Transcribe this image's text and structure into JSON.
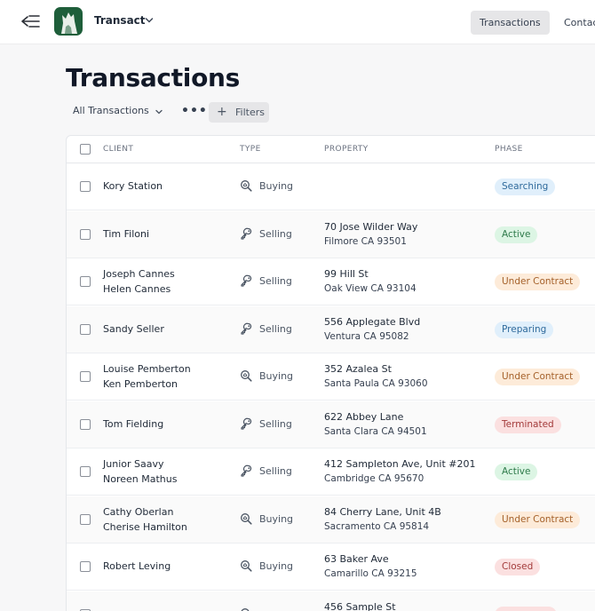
{
  "header": {
    "app_name": "Transact",
    "tabs": [
      {
        "label": "Transactions",
        "active": true
      },
      {
        "label": "Contacts",
        "active": false
      }
    ]
  },
  "page": {
    "title": "Transactions",
    "view_select": "All Transactions",
    "filters_label": "Filters"
  },
  "table": {
    "columns": [
      "CLIENT",
      "TYPE",
      "PROPERTY",
      "PHASE"
    ],
    "rows": [
      {
        "clients": [
          "Kory Station"
        ],
        "type": "Buying",
        "type_icon": "search-home-icon",
        "address": "",
        "city": "",
        "phase": "Searching",
        "phase_color": "blue"
      },
      {
        "clients": [
          "Tim Filoni"
        ],
        "type": "Selling",
        "type_icon": "key-icon",
        "address": "70 Jose Wilder Way",
        "city": "Filmore CA 93501",
        "phase": "Active",
        "phase_color": "green"
      },
      {
        "clients": [
          "Joseph Cannes",
          "Helen Cannes"
        ],
        "type": "Selling",
        "type_icon": "key-icon",
        "address": "99 Hill St",
        "city": "Oak View CA 93104",
        "phase": "Under Contract",
        "phase_color": "orange"
      },
      {
        "clients": [
          "Sandy Seller"
        ],
        "type": "Selling",
        "type_icon": "key-icon",
        "address": "556 Applegate Blvd",
        "city": "Ventura CA 95082",
        "phase": "Preparing",
        "phase_color": "blue"
      },
      {
        "clients": [
          "Louise Pemberton",
          "Ken Pemberton"
        ],
        "type": "Buying",
        "type_icon": "search-home-icon",
        "address": "352 Azalea St",
        "city": "Santa Paula CA 93060",
        "phase": "Under Contract",
        "phase_color": "orange"
      },
      {
        "clients": [
          "Tom Fielding"
        ],
        "type": "Selling",
        "type_icon": "key-icon",
        "address": "622 Abbey Lane",
        "city": "Santa Clara CA 94501",
        "phase": "Terminated",
        "phase_color": "red"
      },
      {
        "clients": [
          "Junior Saavy",
          "Noreen Mathus"
        ],
        "type": "Selling",
        "type_icon": "key-icon",
        "address": "412 Sampleton Ave, Unit #201",
        "city": "Cambridge CA 95670",
        "phase": "Active",
        "phase_color": "green"
      },
      {
        "clients": [
          "Cathy Oberlan",
          "Cherise Hamilton"
        ],
        "type": "Buying",
        "type_icon": "search-home-icon",
        "address": "84 Cherry Lane, Unit 4B",
        "city": "Sacramento CA 95814",
        "phase": "Under Contract",
        "phase_color": "orange"
      },
      {
        "clients": [
          "Robert Leving"
        ],
        "type": "Buying",
        "type_icon": "search-home-icon",
        "address": "63 Baker Ave",
        "city": "Camarillo CA 93215",
        "phase": "Closed",
        "phase_color": "red"
      },
      {
        "clients": [
          ""
        ],
        "type": "",
        "type_icon": "search-home-icon",
        "address": "456 Sample St",
        "city": "",
        "phase": "",
        "phase_color": "red"
      }
    ]
  },
  "colors": {
    "logo_bg": "#1e5e3a",
    "badge_blue_bg": "#e0effb",
    "badge_blue_fg": "#2f6a9c",
    "badge_green_bg": "#dcf5e4",
    "badge_green_fg": "#2e7a4a",
    "badge_orange_bg": "#fdebd9",
    "badge_orange_fg": "#a5612a",
    "badge_red_bg": "#fbe0e0",
    "badge_red_fg": "#a33a3a"
  }
}
